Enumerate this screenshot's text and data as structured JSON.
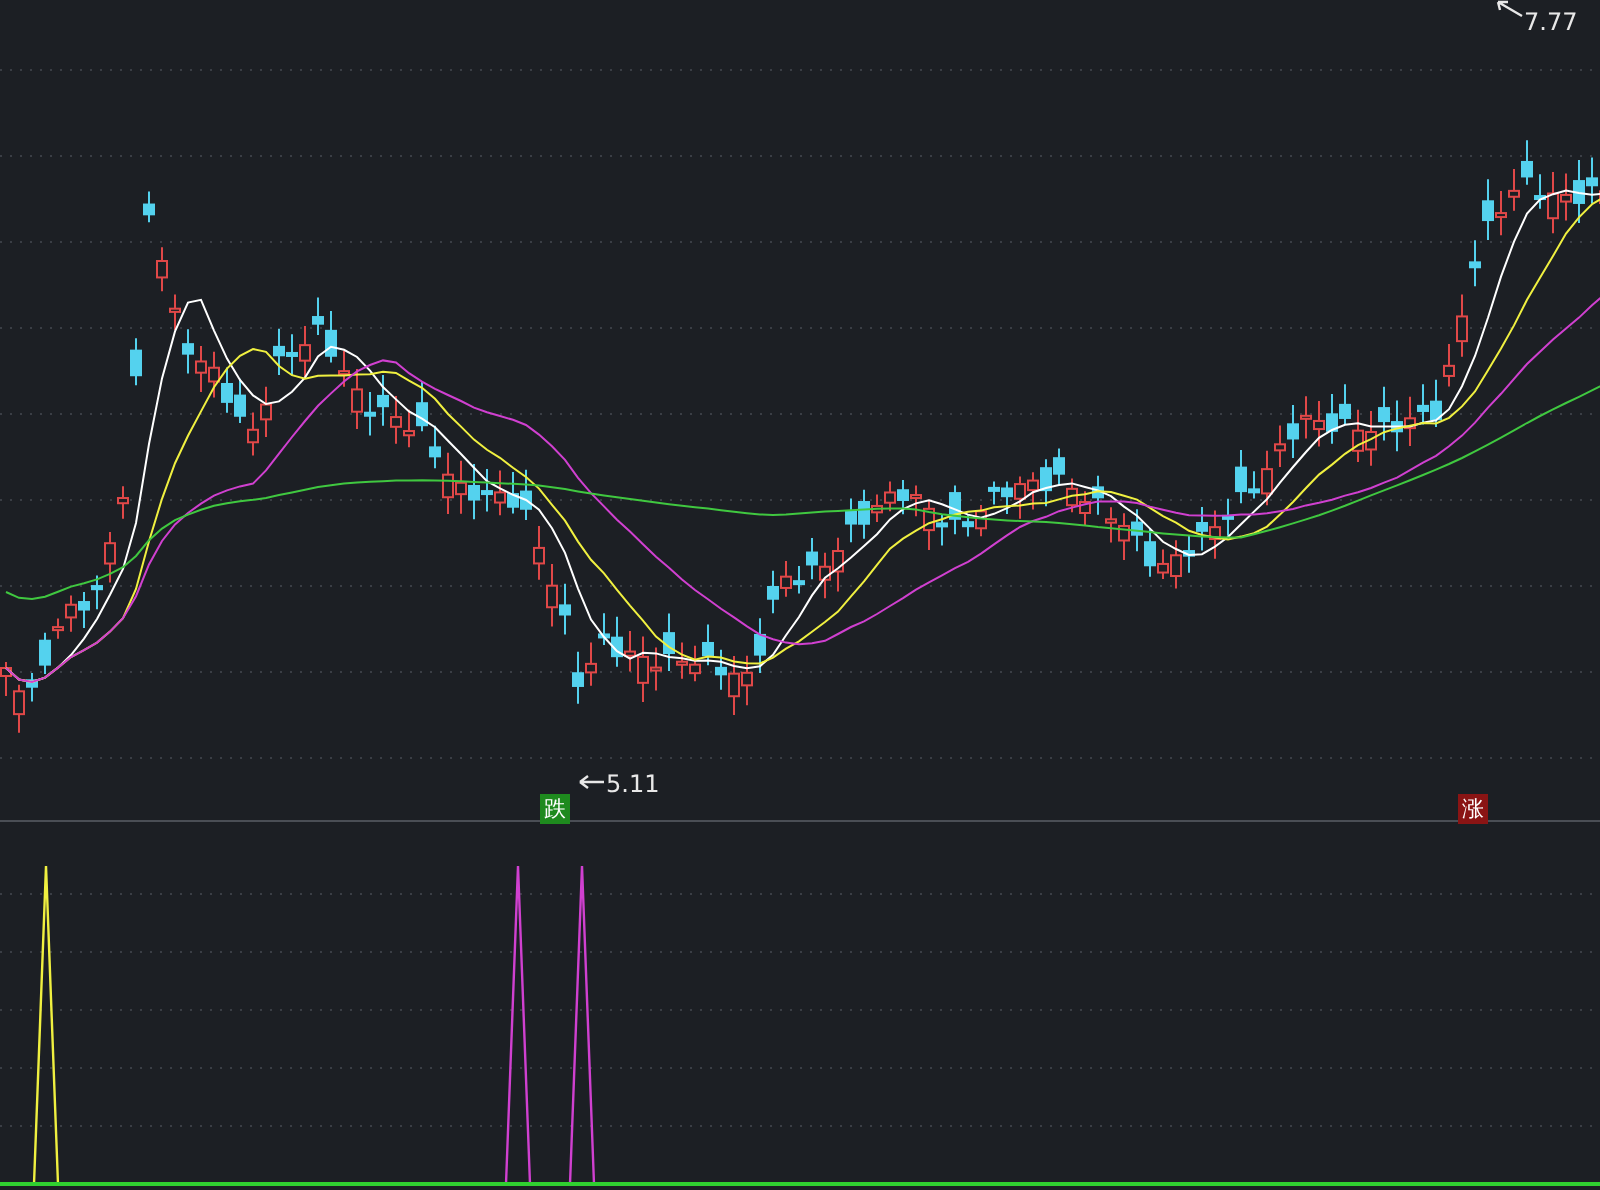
{
  "price_chart": {
    "high_label": "7.77",
    "low_label": "5.11",
    "signals": [
      {
        "label": "跌",
        "kind": "down"
      },
      {
        "label": "涨",
        "kind": "up"
      }
    ]
  }
}
